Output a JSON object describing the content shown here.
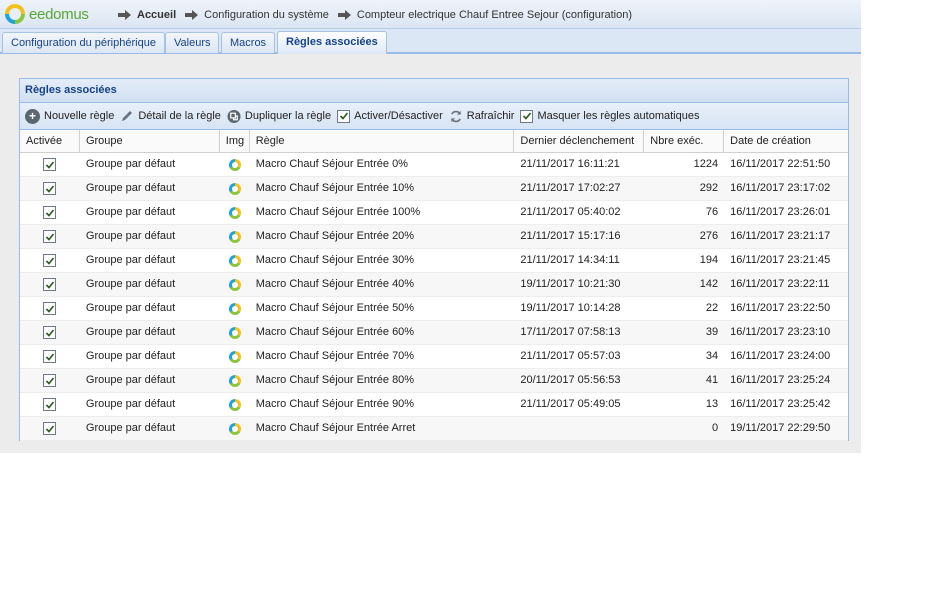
{
  "header": {
    "logo_text": "eedomus",
    "breadcrumbs": [
      {
        "label": "Accueil"
      },
      {
        "label": "Configuration du système"
      },
      {
        "label": "Compteur electrique Chauf Entree Sejour (configuration)"
      }
    ]
  },
  "tabs": [
    {
      "label": "Configuration du périphérique",
      "active": false
    },
    {
      "label": "Valeurs",
      "active": false
    },
    {
      "label": "Macros",
      "active": false
    },
    {
      "label": "Règles associées",
      "active": true
    }
  ],
  "panel": {
    "title": "Règles associées",
    "toolbar": {
      "new_rule": "Nouvelle règle",
      "rule_detail": "Détail de la règle",
      "duplicate_rule": "Dupliquer la règle",
      "toggle": "Activer/Désactiver",
      "refresh": "Rafraîchir",
      "hide_auto": "Masquer les règles automatiques",
      "hide_auto_checked": true
    },
    "columns": {
      "active": "Activée",
      "group": "Groupe",
      "img": "Img",
      "rule": "Règle",
      "last_trigger": "Dernier déclenchement",
      "exec_count": "Nbre exéc.",
      "created": "Date de création"
    },
    "rows": [
      {
        "active": true,
        "group": "Groupe par défaut",
        "rule": "Macro Chauf Séjour Entrée 0%",
        "last_trigger": "21/11/2017 16:11:21",
        "exec_count": "1224",
        "created": "16/11/2017 22:51:50"
      },
      {
        "active": true,
        "group": "Groupe par défaut",
        "rule": "Macro Chauf Séjour Entrée 10%",
        "last_trigger": "21/11/2017 17:02:27",
        "exec_count": "292",
        "created": "16/11/2017 23:17:02"
      },
      {
        "active": true,
        "group": "Groupe par défaut",
        "rule": "Macro Chauf Séjour Entrée 100%",
        "last_trigger": "21/11/2017 05:40:02",
        "exec_count": "76",
        "created": "16/11/2017 23:26:01"
      },
      {
        "active": true,
        "group": "Groupe par défaut",
        "rule": "Macro Chauf Séjour Entrée 20%",
        "last_trigger": "21/11/2017 15:17:16",
        "exec_count": "276",
        "created": "16/11/2017 23:21:17"
      },
      {
        "active": true,
        "group": "Groupe par défaut",
        "rule": "Macro Chauf Séjour Entrée 30%",
        "last_trigger": "21/11/2017 14:34:11",
        "exec_count": "194",
        "created": "16/11/2017 23:21:45"
      },
      {
        "active": true,
        "group": "Groupe par défaut",
        "rule": "Macro Chauf Séjour Entrée 40%",
        "last_trigger": "19/11/2017 10:21:30",
        "exec_count": "142",
        "created": "16/11/2017 23:22:11"
      },
      {
        "active": true,
        "group": "Groupe par défaut",
        "rule": "Macro Chauf Séjour Entrée 50%",
        "last_trigger": "19/11/2017 10:14:28",
        "exec_count": "22",
        "created": "16/11/2017 23:22:50"
      },
      {
        "active": true,
        "group": "Groupe par défaut",
        "rule": "Macro Chauf Séjour Entrée 60%",
        "last_trigger": "17/11/2017 07:58:13",
        "exec_count": "39",
        "created": "16/11/2017 23:23:10"
      },
      {
        "active": true,
        "group": "Groupe par défaut",
        "rule": "Macro Chauf Séjour Entrée 70%",
        "last_trigger": "21/11/2017 05:57:03",
        "exec_count": "34",
        "created": "16/11/2017 23:24:00"
      },
      {
        "active": true,
        "group": "Groupe par défaut",
        "rule": "Macro Chauf Séjour Entrée 80%",
        "last_trigger": "20/11/2017 05:56:53",
        "exec_count": "41",
        "created": "16/11/2017 23:25:24"
      },
      {
        "active": true,
        "group": "Groupe par défaut",
        "rule": "Macro Chauf Séjour Entrée 90%",
        "last_trigger": "21/11/2017 05:49:05",
        "exec_count": "13",
        "created": "16/11/2017 23:25:42"
      },
      {
        "active": true,
        "group": "Groupe par défaut",
        "rule": "Macro Chauf Séjour Entrée Arret",
        "last_trigger": "",
        "exec_count": "0",
        "created": "19/11/2017 22:29:50"
      }
    ]
  }
}
